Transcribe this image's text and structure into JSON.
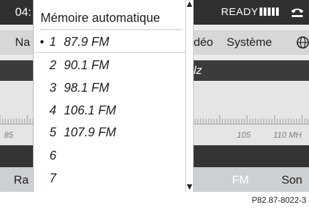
{
  "status_bar": {
    "clock": "04:",
    "ready_label": "READY",
    "signal_bars": 5
  },
  "menu_bar": {
    "items": [
      "Na",
      "déo",
      "Système"
    ]
  },
  "band_strip": {
    "fragment": "lz"
  },
  "scale": {
    "labels": [
      "85",
      "105",
      "110 MH"
    ]
  },
  "bottom_bar": {
    "items": [
      "Ra",
      "FM",
      "Son"
    ]
  },
  "popup": {
    "title": "Mémoire automatique",
    "items": [
      {
        "bullet": "•",
        "number": "1",
        "frequency": "87.9 FM"
      },
      {
        "bullet": "",
        "number": "2",
        "frequency": "90.1 FM"
      },
      {
        "bullet": "",
        "number": "3",
        "frequency": "98.1 FM"
      },
      {
        "bullet": "",
        "number": "4",
        "frequency": "106.1 FM"
      },
      {
        "bullet": "",
        "number": "5",
        "frequency": "107.9 FM"
      },
      {
        "bullet": "",
        "number": "6",
        "frequency": ""
      },
      {
        "bullet": "",
        "number": "7",
        "frequency": ""
      }
    ]
  },
  "caption": "P82.87-8022-3",
  "colors": {
    "status_bar": "#2f3031",
    "menu_bar": "#d5d7d9",
    "popup_bg": "#ffffff",
    "dark_strip": "#333435"
  }
}
